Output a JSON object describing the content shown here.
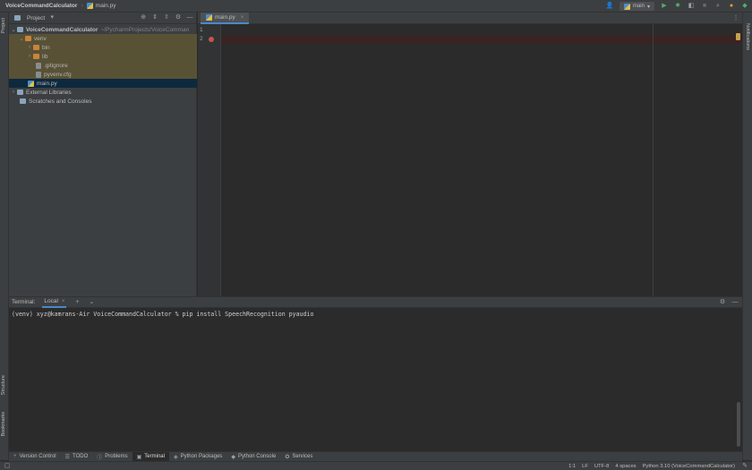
{
  "navbar": {
    "project_name": "VoiceCommandCalculator",
    "file_crumb": "main.py",
    "run_config": "main"
  },
  "left_stripe": {
    "project": "Project",
    "structure": "Structure",
    "bookmarks": "Bookmarks"
  },
  "right_stripe": {
    "notifications": "Notifications"
  },
  "project_panel": {
    "title": "Project",
    "tree": [
      {
        "label": "VoiceCommandCalculator",
        "path": "~/PycharmProjects/VoiceComman"
      },
      {
        "label": "venv"
      },
      {
        "label": "bin"
      },
      {
        "label": "lib"
      },
      {
        "label": ".gitignore"
      },
      {
        "label": "pyvenv.cfg"
      },
      {
        "label": "main.py"
      },
      {
        "label": "External Libraries"
      },
      {
        "label": "Scratches and Consoles"
      }
    ]
  },
  "editor": {
    "tab_label": "main.py",
    "line_numbers": [
      "1",
      "2"
    ]
  },
  "terminal": {
    "label": "Terminal:",
    "tab_label": "Local",
    "command_line": "(venv) xyz@kamrans-Air VoiceCommandCalculator % pip install SpeechRecognition pyaudio"
  },
  "tool_windows": [
    {
      "label": "Version Control"
    },
    {
      "label": "TODO"
    },
    {
      "label": "Problems"
    },
    {
      "label": "Terminal"
    },
    {
      "label": "Python Packages"
    },
    {
      "label": "Python Console"
    },
    {
      "label": "Services"
    }
  ],
  "status_bar": {
    "position": "1:1",
    "line_separator": "LF",
    "encoding": "UTF-8",
    "indent": "4 spaces",
    "interpreter": "Python 3.10 (VoiceCommandCalculator)"
  }
}
